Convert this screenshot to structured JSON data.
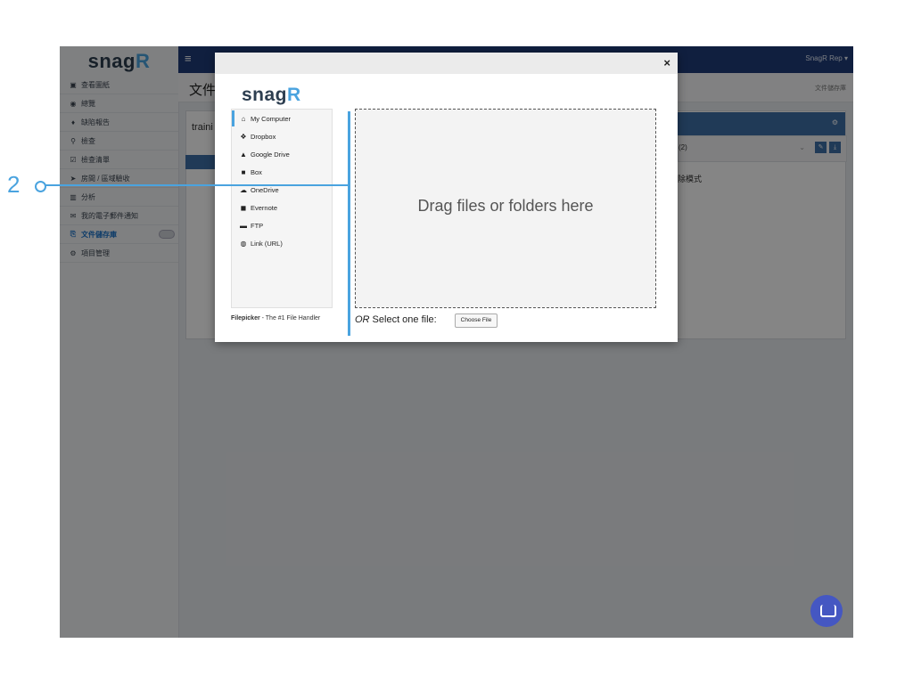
{
  "sidebar": {
    "logo": "snag",
    "logo_r": "R",
    "items": [
      {
        "label": "查看圖紙",
        "icon": "image-icon"
      },
      {
        "label": "總覽",
        "icon": "dashboard-icon"
      },
      {
        "label": "缺陷報告",
        "icon": "map-marker-icon"
      },
      {
        "label": "檢查",
        "icon": "search-icon"
      },
      {
        "label": "檢查清單",
        "icon": "checkbox-icon"
      },
      {
        "label": "房間 / 區域驗收",
        "icon": "location-arrow-icon"
      },
      {
        "label": "分析",
        "icon": "bar-chart-icon"
      },
      {
        "label": "我的電子郵件通知",
        "icon": "envelope-icon"
      },
      {
        "label": "文件儲存庫",
        "icon": "files-icon"
      },
      {
        "label": "項目管理",
        "icon": "cogs-icon"
      }
    ]
  },
  "topbar": {
    "user": "SnagR Rep ▾"
  },
  "page": {
    "title": "文件",
    "breadcrumb": "文件儲存庫",
    "input_value": "traini",
    "row_text": "(2)",
    "mode_text": "除模式"
  },
  "modal": {
    "logo": "snag",
    "logo_r": "R",
    "close": "×",
    "sources": [
      {
        "label": "My Computer",
        "icon": "home-icon"
      },
      {
        "label": "Dropbox",
        "icon": "dropbox-icon"
      },
      {
        "label": "Google Drive",
        "icon": "google-drive-icon"
      },
      {
        "label": "Box",
        "icon": "box-icon"
      },
      {
        "label": "OneDrive",
        "icon": "onedrive-icon"
      },
      {
        "label": "Evernote",
        "icon": "evernote-icon"
      },
      {
        "label": "FTP",
        "icon": "ftp-icon"
      },
      {
        "label": "Link (URL)",
        "icon": "link-icon"
      }
    ],
    "dropzone_text": "Drag files or folders here",
    "footer_brand": "Filepicker",
    "footer_tagline": " - The #1 File Handler",
    "or_text": "OR",
    "select_text": " Select one file:",
    "choose_button": "Choose File"
  },
  "annotation": {
    "number": "2"
  },
  "colors": {
    "accent": "#4aa3df",
    "topbar": "#1f3c7a",
    "chat": "#4557c2"
  }
}
